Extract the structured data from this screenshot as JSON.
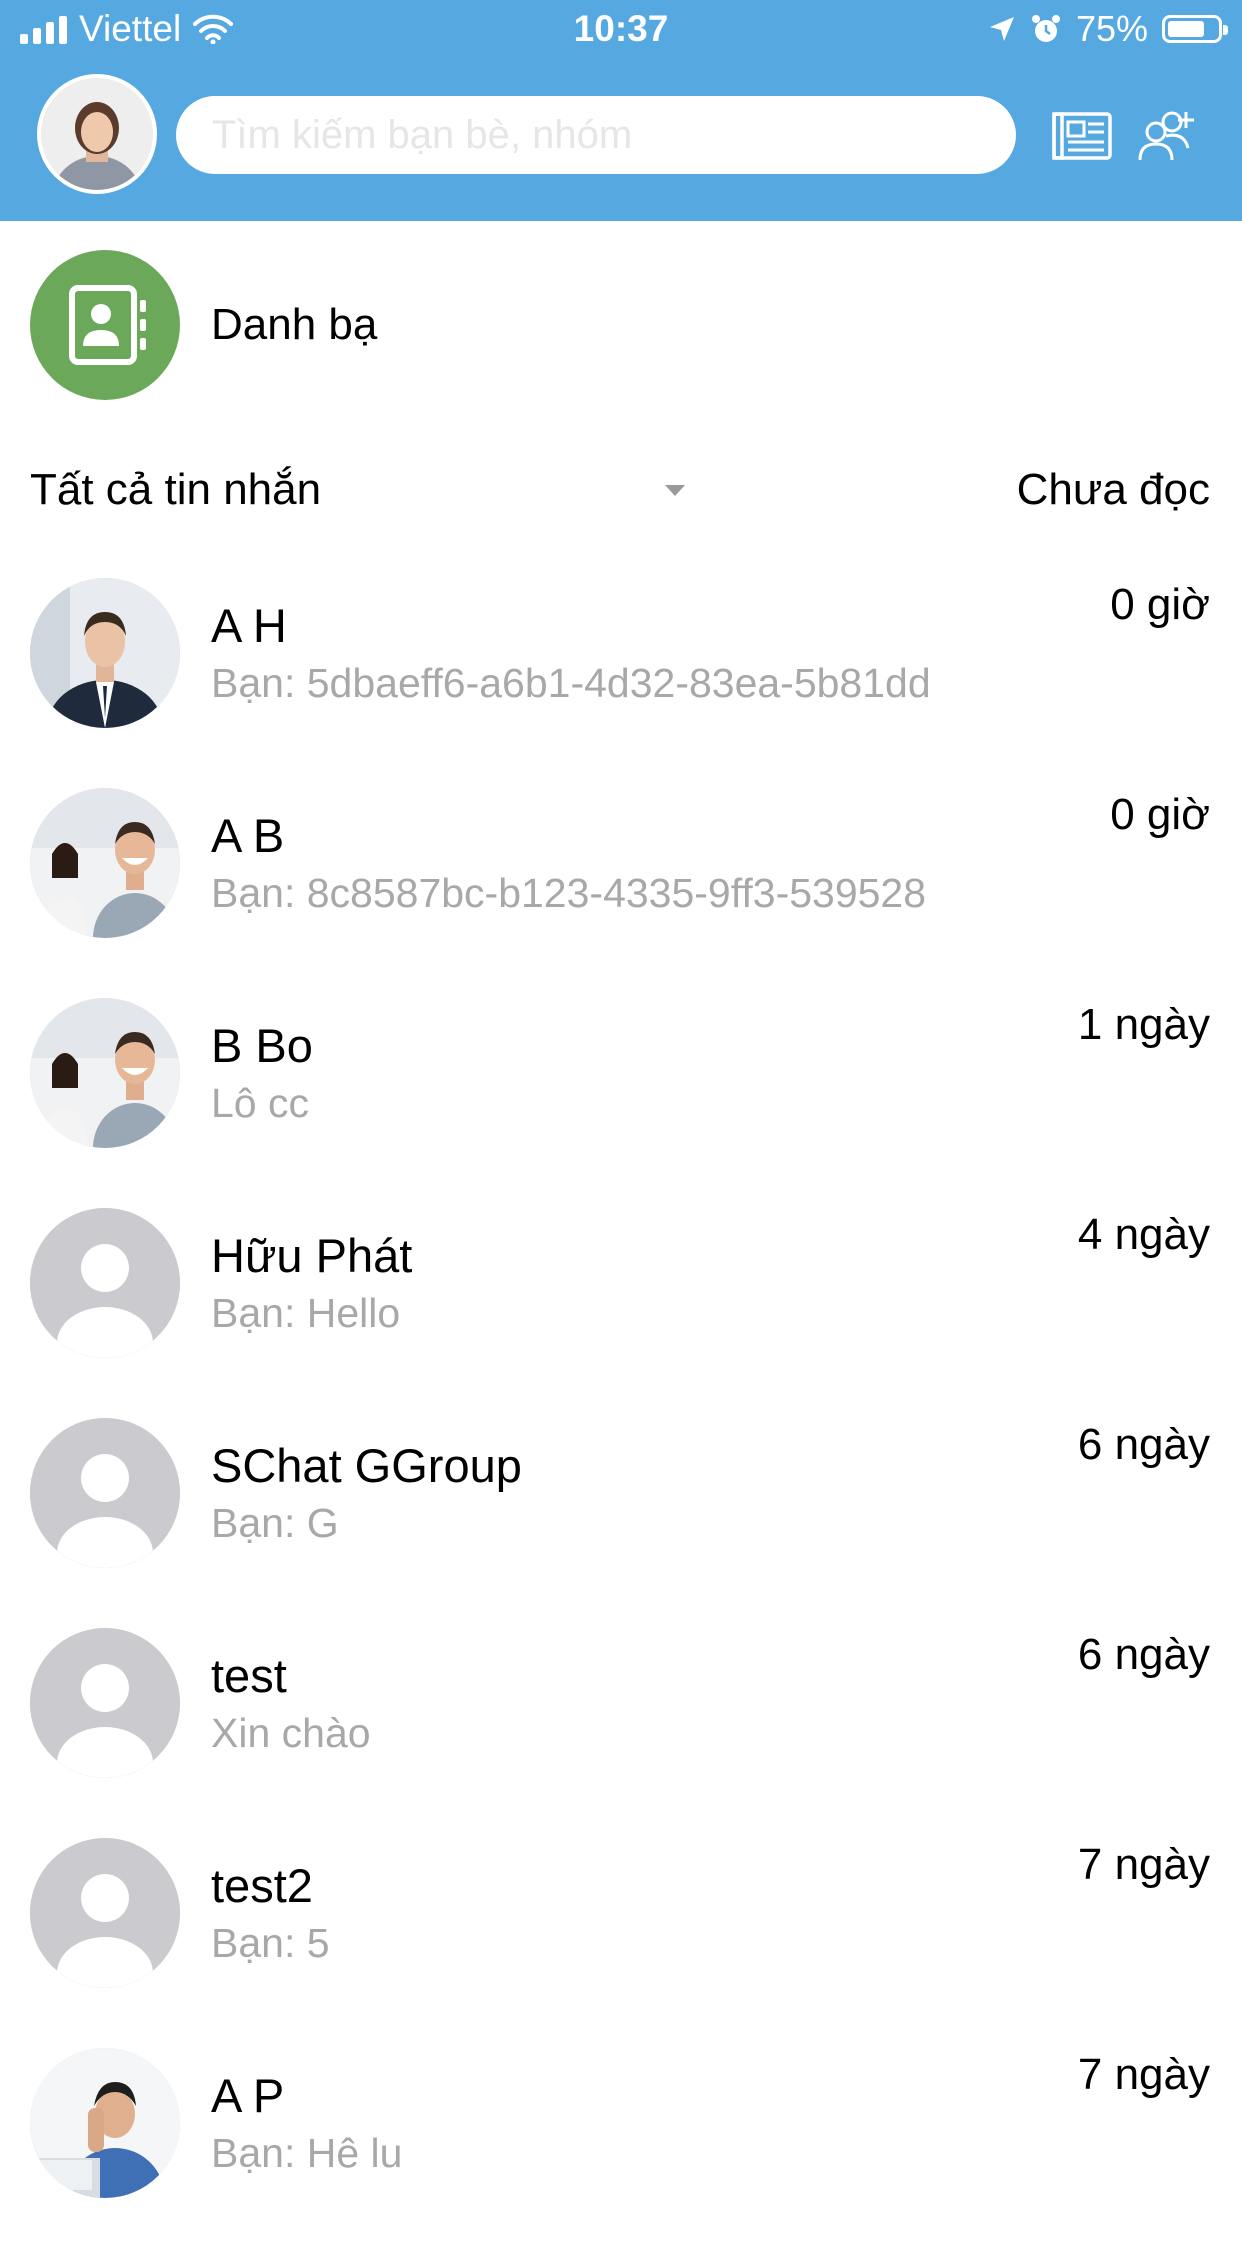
{
  "status_bar": {
    "carrier": "Viettel",
    "time": "10:37",
    "battery_percent": "75%",
    "battery_level": 0.75
  },
  "header": {
    "search_placeholder": "Tìm kiếm bạn bè, nhóm",
    "icons": [
      "news-icon",
      "add-user-icon"
    ],
    "background_color": "#55a8e0"
  },
  "contacts": {
    "label": "Danh bạ",
    "icon_color": "#6ba85a"
  },
  "filter": {
    "label": "Tất cả tin nhắn",
    "unread_label": "Chưa đọc"
  },
  "conversations": [
    {
      "name": "A H",
      "message": "Bạn: 5dbaeff6-a6b1-4d32-83ea-5b81dd",
      "time": "0 giờ",
      "avatar": "photo-man-suit"
    },
    {
      "name": "A B",
      "message": "Bạn: 8c8587bc-b123-4335-9ff3-539528",
      "time": "0 giờ",
      "avatar": "photo-group"
    },
    {
      "name": "B Bo",
      "message": "Lô cc",
      "time": "1 ngày",
      "avatar": "photo-group"
    },
    {
      "name": "Hữu Phát",
      "message": "Bạn: Hello",
      "time": "4 ngày",
      "avatar": "default"
    },
    {
      "name": "SChat GGroup",
      "message": "Bạn: G",
      "time": "6 ngày",
      "avatar": "default"
    },
    {
      "name": "test",
      "message": "Xin chào",
      "time": "6 ngày",
      "avatar": "default"
    },
    {
      "name": "test2",
      "message": "Bạn: 5",
      "time": "7 ngày",
      "avatar": "default"
    },
    {
      "name": "A P",
      "message": "Bạn: Hê lu",
      "time": "7 ngày",
      "avatar": "photo-stressed-man"
    }
  ]
}
